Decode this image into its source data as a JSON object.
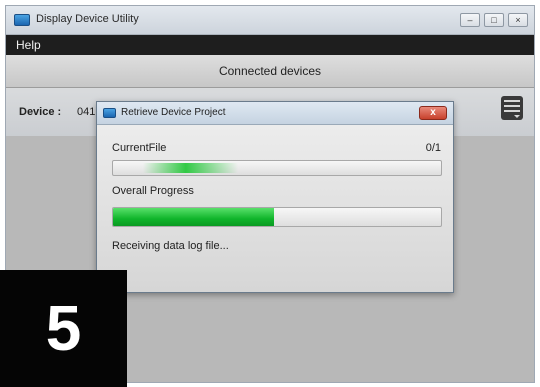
{
  "window": {
    "title": "Display Device Utility",
    "controls": {
      "minimize": "–",
      "maximize": "□",
      "close": "×"
    }
  },
  "menubar": {
    "items": [
      "Help"
    ]
  },
  "section_header": "Connected devices",
  "device": {
    "label": "Device :",
    "value": "041"
  },
  "menu_icon": "hamburger-menu-icon",
  "dialog": {
    "title": "Retrieve Device Project",
    "close_label": "x",
    "current_file_label": "CurrentFile",
    "current_file_count": "0/1",
    "overall_label": "Overall Progress",
    "overall_progress_fraction": 0.49,
    "status": "Receiving data log file..."
  },
  "step_number": "5",
  "colors": {
    "progress_green": "#10b52b",
    "menubar": "#1e1e1e",
    "close_red": "#c7412c"
  }
}
